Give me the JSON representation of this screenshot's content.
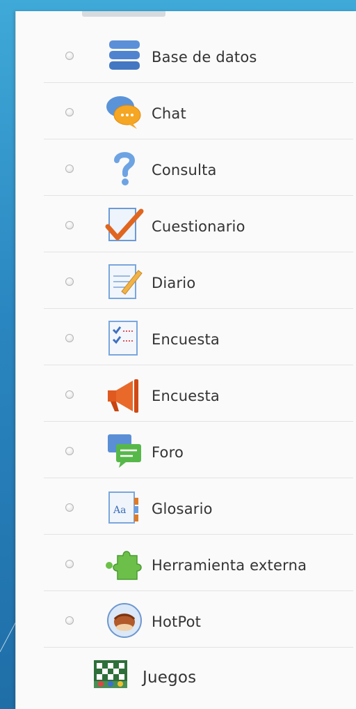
{
  "activities": [
    {
      "label": "Base de datos",
      "icon": "database-icon",
      "radio": true
    },
    {
      "label": "Chat",
      "icon": "chat-icon",
      "radio": true
    },
    {
      "label": "Consulta",
      "icon": "question-icon",
      "radio": true
    },
    {
      "label": "Cuestionario",
      "icon": "quiz-icon",
      "radio": true
    },
    {
      "label": "Diario",
      "icon": "journal-icon",
      "radio": true
    },
    {
      "label": "Encuesta",
      "icon": "survey-icon",
      "radio": true
    },
    {
      "label": "Encuesta",
      "icon": "feedback-megaphone-icon",
      "radio": true
    },
    {
      "label": "Foro",
      "icon": "forum-icon",
      "radio": true
    },
    {
      "label": "Glosario",
      "icon": "glossary-icon",
      "radio": true
    },
    {
      "label": "Herramienta externa",
      "icon": "puzzle-icon",
      "radio": true
    },
    {
      "label": "HotPot",
      "icon": "hotpot-icon",
      "radio": true
    },
    {
      "label": "Juegos",
      "icon": "games-icon",
      "radio": false
    }
  ],
  "colors": {
    "background_top": "#3fa9d8",
    "background_bottom": "#1f6ea8",
    "panel": "#fafafa",
    "text": "#333333"
  }
}
